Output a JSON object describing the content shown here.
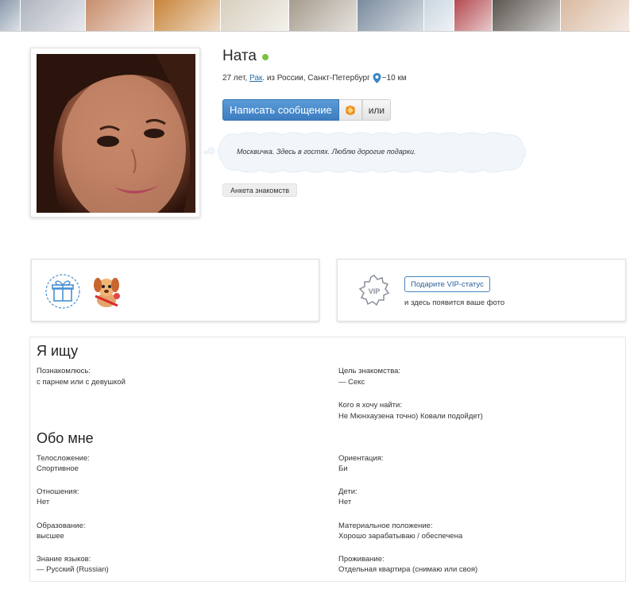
{
  "photo_strip": {
    "thumbs": [
      {
        "w": 26,
        "color": "#8a9aac"
      },
      {
        "w": 82,
        "color": "#aeb4bf"
      },
      {
        "w": 86,
        "color": "#c88e6d"
      },
      {
        "w": 84,
        "color": "#c8843a"
      },
      {
        "w": 86,
        "color": "#d7cfbe"
      },
      {
        "w": 86,
        "color": "#a69c8d"
      },
      {
        "w": 84,
        "color": "#7a8b9e"
      },
      {
        "w": 38,
        "color": "#c9d6e0"
      },
      {
        "w": 48,
        "color": "#b34a50"
      },
      {
        "w": 86,
        "color": "#5c5650"
      },
      {
        "w": 87,
        "color": "#d9b9a0"
      }
    ]
  },
  "profile": {
    "name": "Ната",
    "age": "27 лет,",
    "zodiac": "Рак",
    "from": ". из России, Санкт-Петербург",
    "distance": "~10 км",
    "online": true
  },
  "actions": {
    "message_label": "Написать сообщение",
    "or_label": "или",
    "anketa_label": "Анкета знакомств"
  },
  "status": {
    "text": "Москвичка. Здесь в гостях. Люблю дорогие подарки."
  },
  "vip": {
    "badge_text": "VIP",
    "button_label": "Подарите VIP-статус",
    "note": "и здесь появится ваше фото"
  },
  "looking_for": {
    "title": "Я ищу",
    "meet_label": "Познакомлюсь:",
    "meet_value": "с парнем или с девушкой",
    "goal_label": "Цель знакомства:",
    "goal_value": "— Секс",
    "whom_label": "Кого я хочу найти:",
    "whom_value": "Не Мюнхаузена точно) Ковали подойдет)"
  },
  "about": {
    "title": "Обо мне",
    "fields": [
      {
        "label": "Телосложение:",
        "value": "Спортивное"
      },
      {
        "label": "Ориентация:",
        "value": "Би"
      },
      {
        "label": "Отношения:",
        "value": "Нет"
      },
      {
        "label": "Дети:",
        "value": "Нет"
      },
      {
        "label": "Образование:",
        "value": "высшее"
      },
      {
        "label": "Материальное положение:",
        "value": "Хорошо зарабатываю / обеспечена"
      },
      {
        "label": "Знание языков:",
        "value": "— Русский (Russian)"
      },
      {
        "label": "Проживание:",
        "value": "Отдельная квартира (снимаю или своя)"
      }
    ]
  },
  "colors": {
    "accent": "#3c7dc0",
    "online": "#7cc142",
    "link": "#2a6ca8"
  }
}
